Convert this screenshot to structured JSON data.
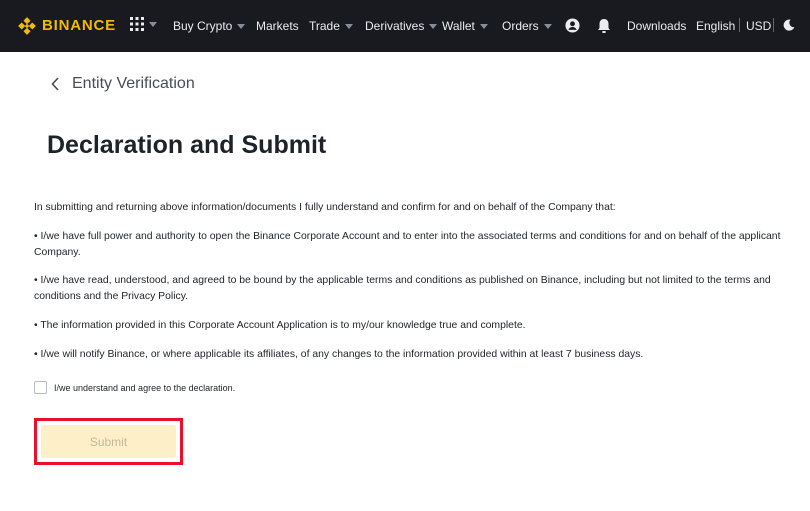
{
  "nav": {
    "brand": "BINANCE",
    "items": {
      "buy_crypto": "Buy Crypto",
      "markets": "Markets",
      "trade": "Trade",
      "derivatives": "Derivatives",
      "wallet": "Wallet",
      "orders": "Orders",
      "downloads": "Downloads",
      "language": "English",
      "currency": "USD"
    },
    "icons": {
      "apps": "apps-grid-icon",
      "profile": "user-icon",
      "notifications": "bell-icon",
      "theme": "moon-icon"
    }
  },
  "page": {
    "back_label": "Entity Verification",
    "title": "Declaration and Submit",
    "intro": "In submitting and returning above information/documents I fully understand and confirm for and on behalf of the Company that:",
    "bullets": [
      "• I/we have full power and authority to open the Binance Corporate Account and to enter into the associated terms and conditions for and on behalf of the applicant Company.",
      "• I/we have read, understood, and agreed to be bound by the applicable terms and conditions as published on Binance, including but not limited to the terms and conditions and the Privacy Policy.",
      "• The information provided in this Corporate Account Application is to my/our knowledge true and complete.",
      "• I/we will notify Binance, or where applicable its affiliates, of any changes to the information provided within at least 7 business days."
    ],
    "checkbox_label": "I/we understand and agree to the declaration.",
    "checkbox_checked": false,
    "submit_label": "Submit"
  },
  "colors": {
    "nav_bg": "#181a20",
    "brand": "#f0b90b",
    "submit_bg": "#fdf0c8",
    "highlight": "#e8112d"
  }
}
